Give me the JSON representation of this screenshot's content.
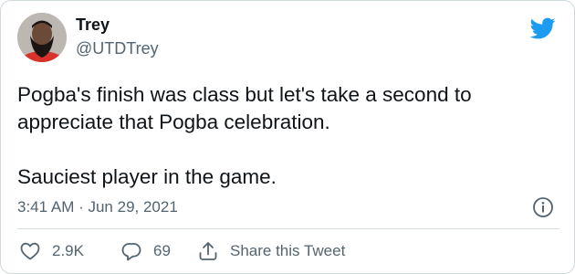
{
  "tweet": {
    "author_name": "Trey",
    "author_handle": "@UTDTrey",
    "text": "Pogba's finish was class but let's take a second to appreciate that Pogba celebration.\n\nSauciest player in the game.",
    "timestamp": "3:41 AM · Jun 29, 2021"
  },
  "actions": {
    "like_count": "2.9K",
    "reply_count": "69",
    "share_label": "Share this Tweet"
  },
  "icons": {
    "brand": "twitter-bird-icon",
    "info": "info-icon",
    "like": "heart-icon",
    "reply": "reply-bubble-icon",
    "share": "share-upload-icon"
  },
  "colors": {
    "twitter_blue": "#1d9bf0",
    "text_primary": "#0f1419",
    "text_secondary": "#536471",
    "border": "#cfd9de"
  }
}
